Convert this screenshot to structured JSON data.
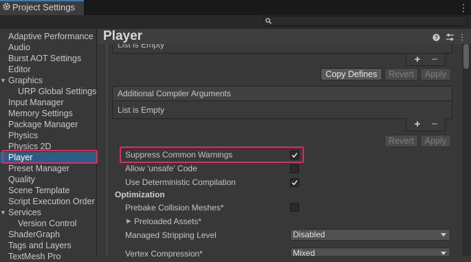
{
  "window": {
    "title": "Project Settings"
  },
  "search": {
    "placeholder": ""
  },
  "sidebar": {
    "items": [
      {
        "label": "Adaptive Performance"
      },
      {
        "label": "Audio"
      },
      {
        "label": "Burst AOT Settings"
      },
      {
        "label": "Editor"
      },
      {
        "label": "Graphics"
      },
      {
        "label": "URP Global Settings"
      },
      {
        "label": "Input Manager"
      },
      {
        "label": "Memory Settings"
      },
      {
        "label": "Package Manager"
      },
      {
        "label": "Physics"
      },
      {
        "label": "Physics 2D"
      },
      {
        "label": "Player"
      },
      {
        "label": "Preset Manager"
      },
      {
        "label": "Quality"
      },
      {
        "label": "Scene Template"
      },
      {
        "label": "Script Execution Order"
      },
      {
        "label": "Services"
      },
      {
        "label": "Version Control"
      },
      {
        "label": "ShaderGraph"
      },
      {
        "label": "Tags and Layers"
      },
      {
        "label": "TextMesh Pro"
      }
    ],
    "selected": "Player"
  },
  "main": {
    "title": "Player",
    "top_list_empty": "List is Empty",
    "copy_defines": "Copy Defines",
    "revert": "Revert",
    "apply": "Apply",
    "compiler_args_header": "Additional Compiler Arguments",
    "compiler_args_empty": "List is Empty",
    "plus": "+",
    "minus": "−",
    "settings": [
      {
        "label": "Suppress Common Warnings",
        "checked": true
      },
      {
        "label": "Allow 'unsafe' Code",
        "checked": false
      },
      {
        "label": "Use Deterministic Compilation",
        "checked": true
      }
    ],
    "optimization_header": "Optimization",
    "prebake_label": "Prebake Collision Meshes*",
    "prebake_checked": false,
    "preloaded_assets": "Preloaded Assets*",
    "stripping_label": "Managed Stripping Level",
    "stripping_value": "Disabled",
    "vertex_label": "Vertex Compression*",
    "vertex_value": "Mixed"
  },
  "colors": {
    "selection": "#2c5d87",
    "highlight": "#e0286a",
    "tab_accent": "#3a79bb"
  }
}
